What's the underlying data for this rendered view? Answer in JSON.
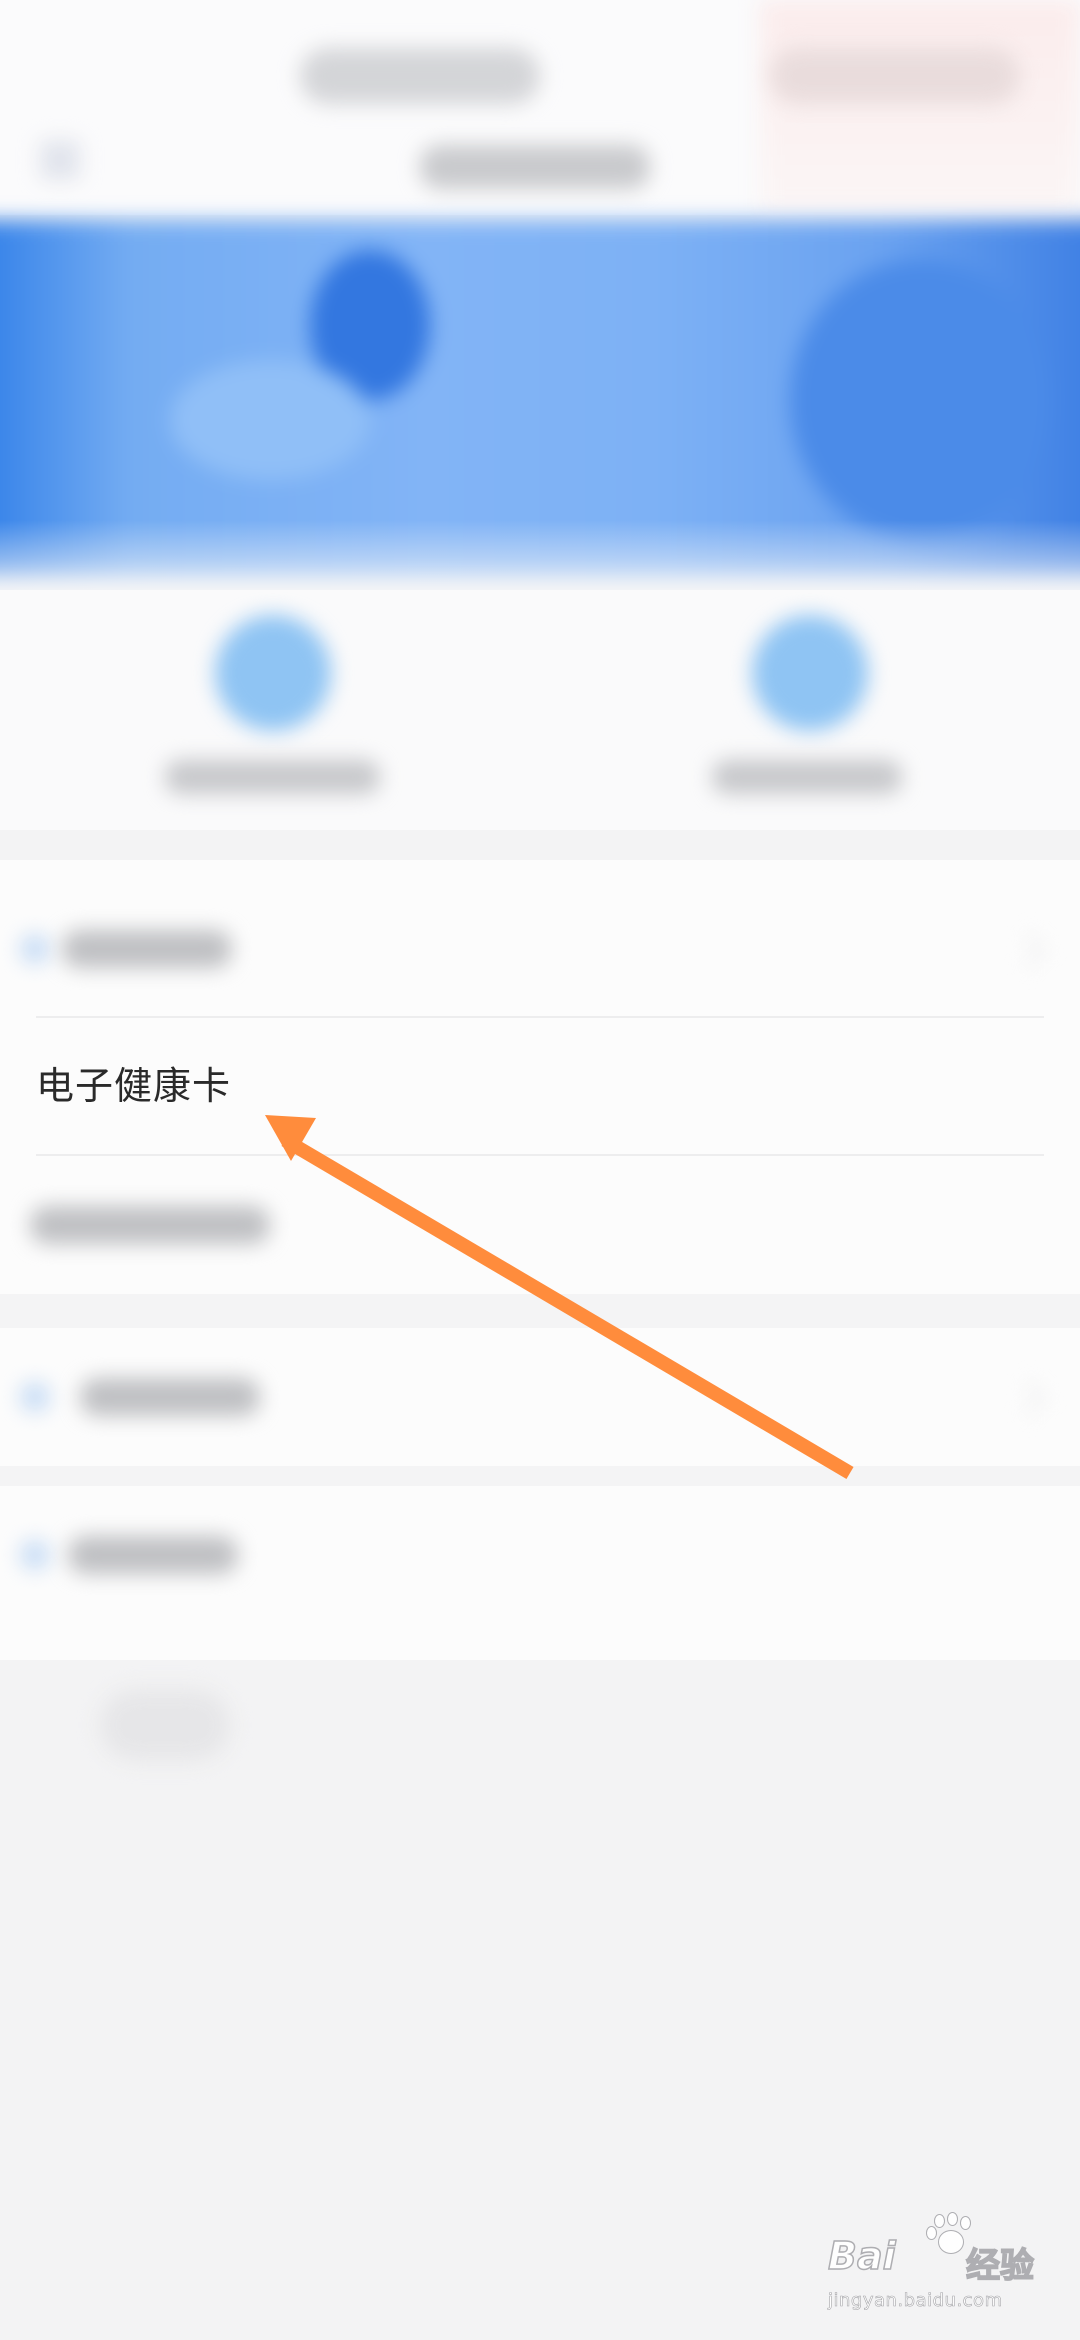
{
  "list": {
    "health_card_label": "电子健康卡"
  },
  "annotation": {
    "arrow_color": "#ff8c3c"
  },
  "colors": {
    "banner_blue": "#7db1f5",
    "page_background": "#f3f3f4"
  },
  "watermark": {
    "brand": "Bai",
    "suffix": "经验",
    "url": "jingyan.baidu.com"
  },
  "icons": {
    "back": "back-arrow-icon",
    "service_1": "service-icon",
    "service_2": "service-icon",
    "chevron": "chevron-right-icon"
  }
}
